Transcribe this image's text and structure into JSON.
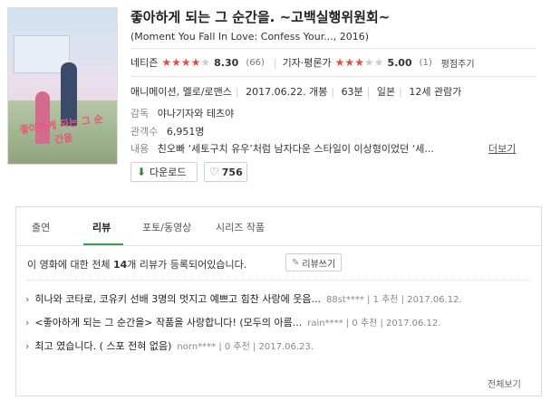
{
  "movie": {
    "title": "좋아하게 되는 그 순간을. ~고백실행위원회~",
    "subtitle": "(Moment You Fall In Love: Confess Your..., 2016)",
    "poster_title": "좋아하게 되는 그 순간을"
  },
  "ratings": {
    "netizen_label": "네티즌",
    "netizen_stars": "★★★★",
    "netizen_stars_off": "★",
    "netizen_score": "8.30",
    "netizen_count": "(66)",
    "critic_label": "기자·평론가",
    "critic_stars": "★★★",
    "critic_stars_off": "★★",
    "critic_score": "5.00",
    "critic_count": "(1)",
    "rate_link": "평점주기"
  },
  "meta": {
    "genre": "애니메이션, 멜로/로맨스",
    "release": "2017.06.22. 개봉",
    "runtime": "63분",
    "country": "일본",
    "age": "12세 관람가",
    "director_label": "감독",
    "director": "야나기자와 테츠야",
    "audience_label": "관객수",
    "audience": "6,951명",
    "content_label": "내용",
    "content": "친오빠 ‘세토구치 유우’처럼 남자다운 스타일이 이상형이었던 ‘세...",
    "more_link": "더보기"
  },
  "actions": {
    "download_label": "다운로드",
    "likes": "756"
  },
  "tabs": [
    {
      "label": "출연"
    },
    {
      "label": "리뷰"
    },
    {
      "label": "포토/동영상"
    },
    {
      "label": "시리즈 작품"
    }
  ],
  "reviews_section": {
    "summary_pre": "이 영화에 대한 전체 ",
    "count": "14",
    "summary_post": "개 리뷰가 등록되어있습니다.",
    "write_label": "리뷰쓰기",
    "items": [
      {
        "title": "히나와 코타로, 코유키 선배 3명의 멋지고 예쁘고 힘찬 사랑에 웃음...",
        "info": "88st**** | 1 추천 | 2017.06.12."
      },
      {
        "title": "<좋아하게 되는 그 순간을> 작품을 사랑합니다! (모두의 아름...",
        "info": "rain**** | 0 추천 | 2017.06.12."
      },
      {
        "title": "최고 였습니다. ( 스포 전혀 없음)",
        "info": "norn**** | 0 추천 | 2017.06.23."
      }
    ],
    "view_all": "전체보기"
  },
  "colors": {
    "accent_green": "#2ea44f",
    "star_red": "#e74c3c"
  }
}
